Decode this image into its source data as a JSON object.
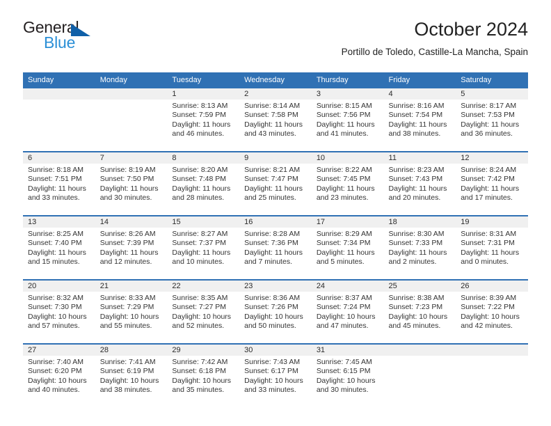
{
  "brand": {
    "name_dark": "General",
    "name_light": "Blue",
    "triangle_color": "#1060a8",
    "blue_color": "#2b8fd6"
  },
  "header": {
    "title": "October 2024",
    "subtitle": "Portillo de Toledo, Castille-La Mancha, Spain"
  },
  "theme": {
    "header_blue": "#3071b4",
    "daynum_band": "#f0f0f0",
    "text": "#333333"
  },
  "weekday_headers": [
    "Sunday",
    "Monday",
    "Tuesday",
    "Wednesday",
    "Thursday",
    "Friday",
    "Saturday"
  ],
  "weeks": [
    [
      {
        "day": "",
        "empty": true,
        "sunrise": "",
        "sunset": "",
        "daylight": ""
      },
      {
        "day": "",
        "empty": true,
        "sunrise": "",
        "sunset": "",
        "daylight": ""
      },
      {
        "day": "1",
        "sunrise": "Sunrise: 8:13 AM",
        "sunset": "Sunset: 7:59 PM",
        "daylight": "Daylight: 11 hours and 46 minutes."
      },
      {
        "day": "2",
        "sunrise": "Sunrise: 8:14 AM",
        "sunset": "Sunset: 7:58 PM",
        "daylight": "Daylight: 11 hours and 43 minutes."
      },
      {
        "day": "3",
        "sunrise": "Sunrise: 8:15 AM",
        "sunset": "Sunset: 7:56 PM",
        "daylight": "Daylight: 11 hours and 41 minutes."
      },
      {
        "day": "4",
        "sunrise": "Sunrise: 8:16 AM",
        "sunset": "Sunset: 7:54 PM",
        "daylight": "Daylight: 11 hours and 38 minutes."
      },
      {
        "day": "5",
        "sunrise": "Sunrise: 8:17 AM",
        "sunset": "Sunset: 7:53 PM",
        "daylight": "Daylight: 11 hours and 36 minutes."
      }
    ],
    [
      {
        "day": "6",
        "sunrise": "Sunrise: 8:18 AM",
        "sunset": "Sunset: 7:51 PM",
        "daylight": "Daylight: 11 hours and 33 minutes."
      },
      {
        "day": "7",
        "sunrise": "Sunrise: 8:19 AM",
        "sunset": "Sunset: 7:50 PM",
        "daylight": "Daylight: 11 hours and 30 minutes."
      },
      {
        "day": "8",
        "sunrise": "Sunrise: 8:20 AM",
        "sunset": "Sunset: 7:48 PM",
        "daylight": "Daylight: 11 hours and 28 minutes."
      },
      {
        "day": "9",
        "sunrise": "Sunrise: 8:21 AM",
        "sunset": "Sunset: 7:47 PM",
        "daylight": "Daylight: 11 hours and 25 minutes."
      },
      {
        "day": "10",
        "sunrise": "Sunrise: 8:22 AM",
        "sunset": "Sunset: 7:45 PM",
        "daylight": "Daylight: 11 hours and 23 minutes."
      },
      {
        "day": "11",
        "sunrise": "Sunrise: 8:23 AM",
        "sunset": "Sunset: 7:43 PM",
        "daylight": "Daylight: 11 hours and 20 minutes."
      },
      {
        "day": "12",
        "sunrise": "Sunrise: 8:24 AM",
        "sunset": "Sunset: 7:42 PM",
        "daylight": "Daylight: 11 hours and 17 minutes."
      }
    ],
    [
      {
        "day": "13",
        "sunrise": "Sunrise: 8:25 AM",
        "sunset": "Sunset: 7:40 PM",
        "daylight": "Daylight: 11 hours and 15 minutes."
      },
      {
        "day": "14",
        "sunrise": "Sunrise: 8:26 AM",
        "sunset": "Sunset: 7:39 PM",
        "daylight": "Daylight: 11 hours and 12 minutes."
      },
      {
        "day": "15",
        "sunrise": "Sunrise: 8:27 AM",
        "sunset": "Sunset: 7:37 PM",
        "daylight": "Daylight: 11 hours and 10 minutes."
      },
      {
        "day": "16",
        "sunrise": "Sunrise: 8:28 AM",
        "sunset": "Sunset: 7:36 PM",
        "daylight": "Daylight: 11 hours and 7 minutes."
      },
      {
        "day": "17",
        "sunrise": "Sunrise: 8:29 AM",
        "sunset": "Sunset: 7:34 PM",
        "daylight": "Daylight: 11 hours and 5 minutes."
      },
      {
        "day": "18",
        "sunrise": "Sunrise: 8:30 AM",
        "sunset": "Sunset: 7:33 PM",
        "daylight": "Daylight: 11 hours and 2 minutes."
      },
      {
        "day": "19",
        "sunrise": "Sunrise: 8:31 AM",
        "sunset": "Sunset: 7:31 PM",
        "daylight": "Daylight: 11 hours and 0 minutes."
      }
    ],
    [
      {
        "day": "20",
        "sunrise": "Sunrise: 8:32 AM",
        "sunset": "Sunset: 7:30 PM",
        "daylight": "Daylight: 10 hours and 57 minutes."
      },
      {
        "day": "21",
        "sunrise": "Sunrise: 8:33 AM",
        "sunset": "Sunset: 7:29 PM",
        "daylight": "Daylight: 10 hours and 55 minutes."
      },
      {
        "day": "22",
        "sunrise": "Sunrise: 8:35 AM",
        "sunset": "Sunset: 7:27 PM",
        "daylight": "Daylight: 10 hours and 52 minutes."
      },
      {
        "day": "23",
        "sunrise": "Sunrise: 8:36 AM",
        "sunset": "Sunset: 7:26 PM",
        "daylight": "Daylight: 10 hours and 50 minutes."
      },
      {
        "day": "24",
        "sunrise": "Sunrise: 8:37 AM",
        "sunset": "Sunset: 7:24 PM",
        "daylight": "Daylight: 10 hours and 47 minutes."
      },
      {
        "day": "25",
        "sunrise": "Sunrise: 8:38 AM",
        "sunset": "Sunset: 7:23 PM",
        "daylight": "Daylight: 10 hours and 45 minutes."
      },
      {
        "day": "26",
        "sunrise": "Sunrise: 8:39 AM",
        "sunset": "Sunset: 7:22 PM",
        "daylight": "Daylight: 10 hours and 42 minutes."
      }
    ],
    [
      {
        "day": "27",
        "sunrise": "Sunrise: 7:40 AM",
        "sunset": "Sunset: 6:20 PM",
        "daylight": "Daylight: 10 hours and 40 minutes."
      },
      {
        "day": "28",
        "sunrise": "Sunrise: 7:41 AM",
        "sunset": "Sunset: 6:19 PM",
        "daylight": "Daylight: 10 hours and 38 minutes."
      },
      {
        "day": "29",
        "sunrise": "Sunrise: 7:42 AM",
        "sunset": "Sunset: 6:18 PM",
        "daylight": "Daylight: 10 hours and 35 minutes."
      },
      {
        "day": "30",
        "sunrise": "Sunrise: 7:43 AM",
        "sunset": "Sunset: 6:17 PM",
        "daylight": "Daylight: 10 hours and 33 minutes."
      },
      {
        "day": "31",
        "sunrise": "Sunrise: 7:45 AM",
        "sunset": "Sunset: 6:15 PM",
        "daylight": "Daylight: 10 hours and 30 minutes."
      },
      {
        "day": "",
        "empty": true,
        "sunrise": "",
        "sunset": "",
        "daylight": ""
      },
      {
        "day": "",
        "empty": true,
        "sunrise": "",
        "sunset": "",
        "daylight": ""
      }
    ]
  ]
}
